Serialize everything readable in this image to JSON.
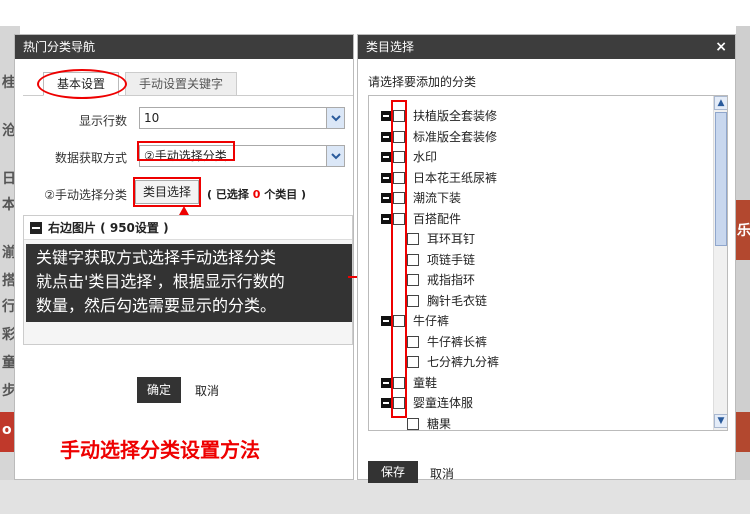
{
  "left_dialog": {
    "title": "热门分类导航",
    "tabs": {
      "basic": "基本设置",
      "manual": "手动设置关键字"
    },
    "rows_label": "显示行数",
    "rows_value": "10",
    "source_label": "数据获取方式",
    "source_value": "②手动选择分类",
    "manual_label": "②手动选择分类",
    "category_button": "类目选择",
    "selected_prefix": "( 已选择",
    "selected_count": "0",
    "selected_suffix": "个类目 )",
    "section_title": "右边图片 ( 950设置 )",
    "confirm_label": "确定",
    "cancel_label": "取消"
  },
  "callout_text": "关键字获取方式选择手动选择分类\n就点击'类目选择'，根据显示行数的\n数量，然后勾选需要显示的分类。",
  "caption": "手动选择分类设置方法",
  "right_dialog": {
    "title": "类目选择",
    "close_label": "×",
    "prompt": "请选择要添加的分类",
    "categories": [
      {
        "label": "扶植版全套装修",
        "child": false
      },
      {
        "label": "标准版全套装修",
        "child": false
      },
      {
        "label": "水印",
        "child": false
      },
      {
        "label": "日本花王纸尿裤",
        "child": false
      },
      {
        "label": "潮流下装",
        "child": false
      },
      {
        "label": "百搭配件",
        "child": false
      },
      {
        "label": "耳环耳钉",
        "child": true
      },
      {
        "label": "项链手链",
        "child": true
      },
      {
        "label": "戒指指环",
        "child": true
      },
      {
        "label": "胸针毛衣链",
        "child": true
      },
      {
        "label": "牛仔裤",
        "child": false
      },
      {
        "label": "牛仔裤长裤",
        "child": true
      },
      {
        "label": "七分裤九分裤",
        "child": true
      },
      {
        "label": "童鞋",
        "child": false
      },
      {
        "label": "婴童连体服",
        "child": false
      },
      {
        "label": "糖果",
        "child": true
      }
    ],
    "save_label": "保存",
    "cancel_label": "取消"
  },
  "background": {
    "left_chars": [
      "桂",
      "沧",
      "日",
      "本",
      "湔",
      "搭",
      "行",
      "彩",
      "童",
      "步",
      "o"
    ],
    "right_char": "乐"
  },
  "colors": {
    "accent_red": "#e00000",
    "title_bar": "#3d3d3d",
    "dark_button": "#333333"
  }
}
